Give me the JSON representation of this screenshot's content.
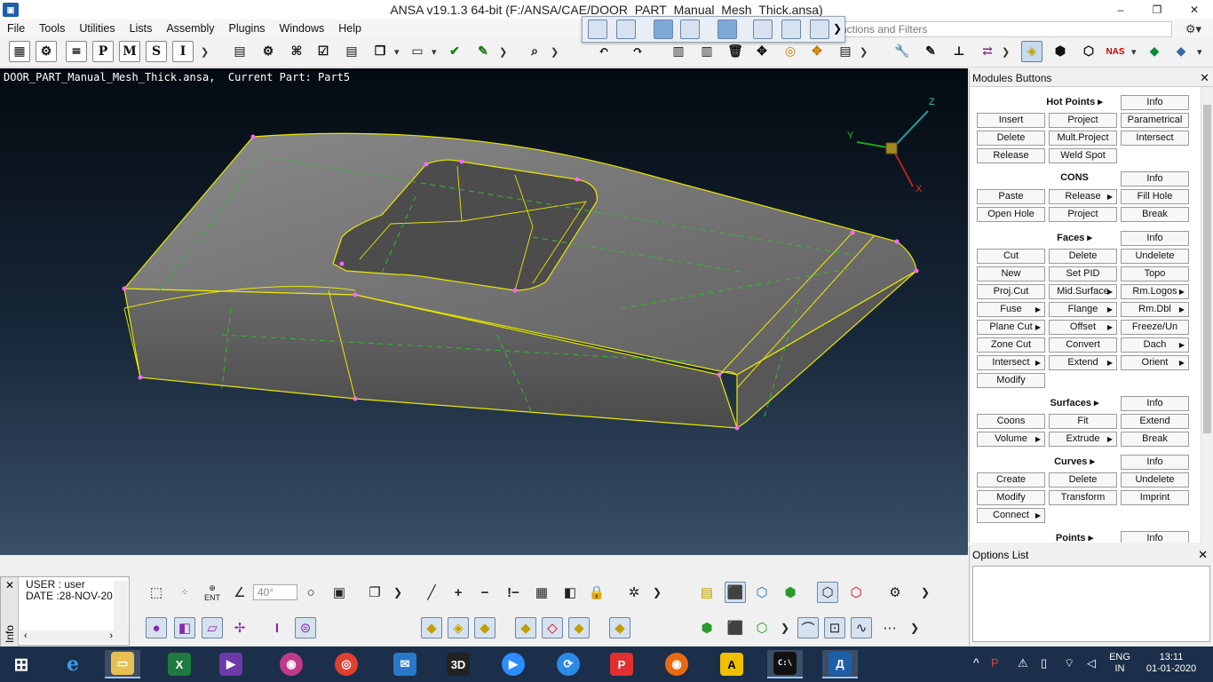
{
  "window": {
    "title": "ANSA v19.1.3 64-bit (F:/ANSA/CAE/DOOR_PART_Manual_Mesh_Thick.ansa)",
    "logo": "ANSA logo",
    "minimize": "–",
    "maximize": "❐",
    "close": "✕"
  },
  "menu": [
    "File",
    "Tools",
    "Utilities",
    "Lists",
    "Assembly",
    "Plugins",
    "Windows",
    "Help"
  ],
  "search": {
    "placeholder": "nctions and Filters"
  },
  "toolbar": {
    "letters": [
      "P",
      "M",
      "S",
      "I"
    ],
    "nas_label": "NAS"
  },
  "viewport": {
    "caption": "DOOR_PART_Manual_Mesh_Thick.ansa,  Current Part: Part5",
    "axes": {
      "x": "X",
      "y": "Y",
      "z": "Z"
    },
    "colors": {
      "surface": "#6b6b6b",
      "edges": "#e8e800",
      "hotpoints": "#ff66ff",
      "dashes": "#2bbf2b"
    }
  },
  "modules": {
    "title": "Modules Buttons",
    "groups": [
      {
        "title": "Hot Points",
        "info": "Info",
        "buttons": [
          {
            "label": "Project"
          },
          {
            "label": "Parametrical"
          },
          {
            "label": "Insert"
          },
          {
            "label": "Mult.Project"
          },
          {
            "label": "Intersect"
          },
          {
            "label": "Delete"
          },
          {
            "label": "Weld Spot"
          },
          {
            "label": "Release"
          }
        ]
      },
      {
        "title": "CONS",
        "info": "Info",
        "buttons": [
          {
            "label": "Paste"
          },
          {
            "label": "Release"
          },
          {
            "label": "Fill Hole"
          },
          {
            "label": "Open Hole"
          },
          {
            "label": "Project"
          },
          {
            "label": "Break"
          }
        ]
      },
      {
        "title": "Faces",
        "info": "Info",
        "buttons": [
          {
            "label": "Cut"
          },
          {
            "label": "Delete"
          },
          {
            "label": "Undelete"
          },
          {
            "label": "New"
          },
          {
            "label": "Set PID"
          },
          {
            "label": "Topo"
          },
          {
            "label": "Proj.Cut"
          },
          {
            "label": "Mid.Surface"
          },
          {
            "label": "Rm.Logos"
          },
          {
            "label": "Fuse"
          },
          {
            "label": "Flange"
          },
          {
            "label": "Rm.Dbl"
          },
          {
            "label": "Plane Cut"
          },
          {
            "label": "Offset"
          },
          {
            "label": "Freeze/Un"
          },
          {
            "label": "Zone Cut"
          },
          {
            "label": "Convert"
          },
          {
            "label": "Dach"
          },
          {
            "label": "Intersect"
          },
          {
            "label": "Extend"
          },
          {
            "label": "Orient"
          },
          {
            "label": "Modify"
          }
        ]
      },
      {
        "title": "Surfaces",
        "info": "Info",
        "buttons": [
          {
            "label": "Coons"
          },
          {
            "label": "Fit"
          },
          {
            "label": "Extend"
          },
          {
            "label": "Volume"
          },
          {
            "label": "Extrude"
          },
          {
            "label": "Break"
          }
        ]
      },
      {
        "title": "Curves",
        "info": "Info",
        "buttons": [
          {
            "label": "Create"
          },
          {
            "label": "Delete"
          },
          {
            "label": "Undelete"
          },
          {
            "label": "Modify"
          },
          {
            "label": "Transform"
          },
          {
            "label": "Imprint"
          },
          {
            "label": "Connect"
          }
        ]
      },
      {
        "title": "Points",
        "info": "Info",
        "buttons": []
      }
    ]
  },
  "options": {
    "title": "Options List",
    "close": "✕"
  },
  "info": {
    "tab": "Info",
    "line1": "USER : user",
    "line2": "DATE :28-NOV-20",
    "close": "✕"
  },
  "bottom": {
    "angle": "40°",
    "ent_label": "ENT"
  },
  "taskbar": {
    "lang1": "ENG",
    "lang2": "IN",
    "time": "13:11",
    "date": "01-01-2020"
  }
}
